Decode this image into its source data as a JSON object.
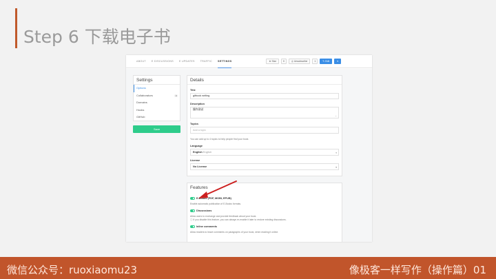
{
  "slide": {
    "title": "Step 6 下载电子书",
    "footer_left": "微信公众号：ruoxiaomu23",
    "footer_right": "像极客一样写作（操作篇）01",
    "accent_color": "#c1552b"
  },
  "topnav": {
    "tabs": [
      "ABOUT",
      "E DISCUSSIONS",
      "E UPDATES",
      "TRAFFIC",
      "SETTINGS"
    ],
    "active_tab": "SETTINGS",
    "star_label": "★ Star",
    "star_count": "0",
    "unsubscribe_label": "◎ Unsubscribe",
    "unsubscribe_count": "1",
    "edit_label": "✎ Edit",
    "edit_dropdown": "▾"
  },
  "sidebar": {
    "title": "Settings",
    "items": [
      {
        "label": "Options",
        "active": true
      },
      {
        "label": "Collaborators",
        "badge": "0"
      },
      {
        "label": "Domains"
      },
      {
        "label": "Hooks"
      },
      {
        "label": "GitHub"
      }
    ],
    "save_label": "Save"
  },
  "details": {
    "title": "Details",
    "title_label": "Title",
    "title_value": "gitbook writing",
    "description_label": "Description",
    "description_value": "操作测试",
    "topics_label": "Topics",
    "topics_placeholder": "Add a topic",
    "topics_help": "You can add up to 4 topics to help people find your book.",
    "language_label": "Language",
    "language_value": "English",
    "language_native": "English",
    "license_label": "License",
    "license_value": "No License"
  },
  "features": {
    "title": "Features",
    "items": [
      {
        "title": "E-Books (PDF, MOBI, EPUB)",
        "desc": "Enable automatic publication of E-Books formats.",
        "enabled": true
      },
      {
        "title": "Discussions",
        "desc": "Allow users to exchange and provide feedback about your book.",
        "desc2": "ⓘ If you disable this feature, you can always re-enable it later to restore existing discussions.",
        "enabled": true
      },
      {
        "title": "Inline comments",
        "desc": "Allow readers to leave comments on paragraphs of your book, when reading it online.",
        "enabled": true
      }
    ]
  }
}
